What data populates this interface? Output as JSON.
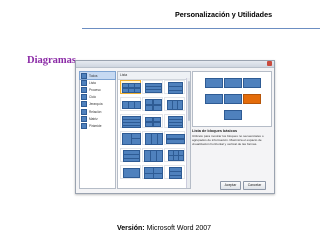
{
  "header": {
    "title": "Personalización y Utilidades"
  },
  "slide": {
    "heading": "Diagramas"
  },
  "footer": {
    "version_label": "Versión:",
    "version_value": "Microsoft Word 2007"
  },
  "dialog": {
    "categories": [
      {
        "label": "Todos",
        "icon": "all-icon",
        "selected": true
      },
      {
        "label": "Lista",
        "icon": "list-icon"
      },
      {
        "label": "Proceso",
        "icon": "process-icon"
      },
      {
        "label": "Ciclo",
        "icon": "cycle-icon"
      },
      {
        "label": "Jerarquía",
        "icon": "hierarchy-icon"
      },
      {
        "label": "Relación",
        "icon": "relationship-icon"
      },
      {
        "label": "Matriz",
        "icon": "matrix-icon"
      },
      {
        "label": "Pirámide",
        "icon": "pyramid-icon"
      }
    ],
    "gallery_header": "Lista",
    "description_title": "Lista de bloques básicos",
    "description_text": "Utilícelo para mostrar los bloques no secuenciales o agrupados de información. Maximiza el espacio de visualización horizontal y vertical de las formas.",
    "buttons": {
      "accept": "Aceptar",
      "cancel": "Cancelar"
    },
    "colors": {
      "accent": "#4f81bd",
      "highlight": "#e46c0a",
      "heading": "#8b2aa6"
    }
  }
}
